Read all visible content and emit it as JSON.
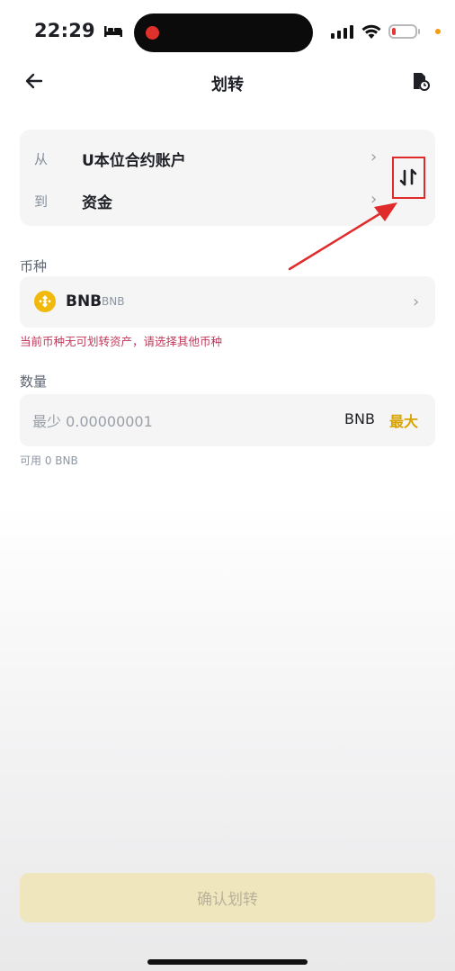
{
  "status_bar": {
    "time": "22:29"
  },
  "header": {
    "title": "划转"
  },
  "transfer": {
    "from_label": "从",
    "from_value": "U本位合约账户",
    "to_label": "到",
    "to_value": "资金"
  },
  "coin": {
    "label": "币种",
    "symbol": "BNB",
    "name": "BNB",
    "error": "当前币种无可划转资产，请选择其他币种"
  },
  "amount": {
    "label": "数量",
    "placeholder": "最少 0.00000001",
    "unit": "BNB",
    "max_label": "最大",
    "available": "可用 0 BNB"
  },
  "confirm_label": "确认划转",
  "colors": {
    "accent": "#d9a400",
    "error": "#c0395a",
    "annotation": "#e02b2b",
    "confirm_disabled": "#efe6bd"
  }
}
